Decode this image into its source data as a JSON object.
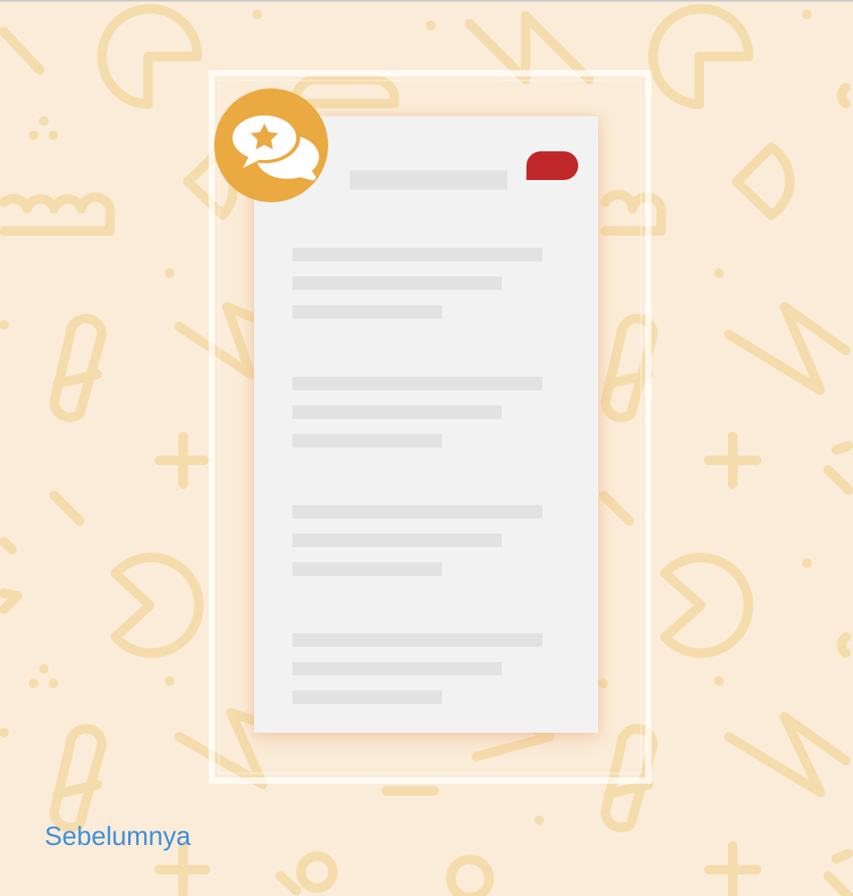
{
  "navigation": {
    "previous_label": "Sebelumnya"
  },
  "icons": {
    "review": "chat-bubbles-star-icon",
    "badge": "red-tag-badge"
  },
  "colors": {
    "background": "#faecd8",
    "pattern": "#f5dcac",
    "card": "#f2f2f2",
    "placeholder": "#e2e2e2",
    "icon_circle": "#eba941",
    "badge_red": "#c0272a",
    "link": "#3f8fdc",
    "top_line": "#c9c9c9"
  }
}
